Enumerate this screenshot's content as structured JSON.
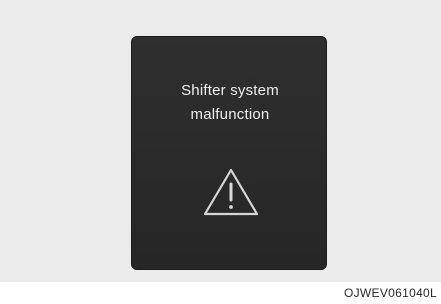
{
  "display": {
    "message_line1": "Shifter system",
    "message_line2": "malfunction",
    "icon": "warning-triangle-icon"
  },
  "figure_code": "OJWEV061040L",
  "colors": {
    "backdrop": "#ebebeb",
    "panel": "#2b2b2b",
    "text": "#ededed"
  }
}
